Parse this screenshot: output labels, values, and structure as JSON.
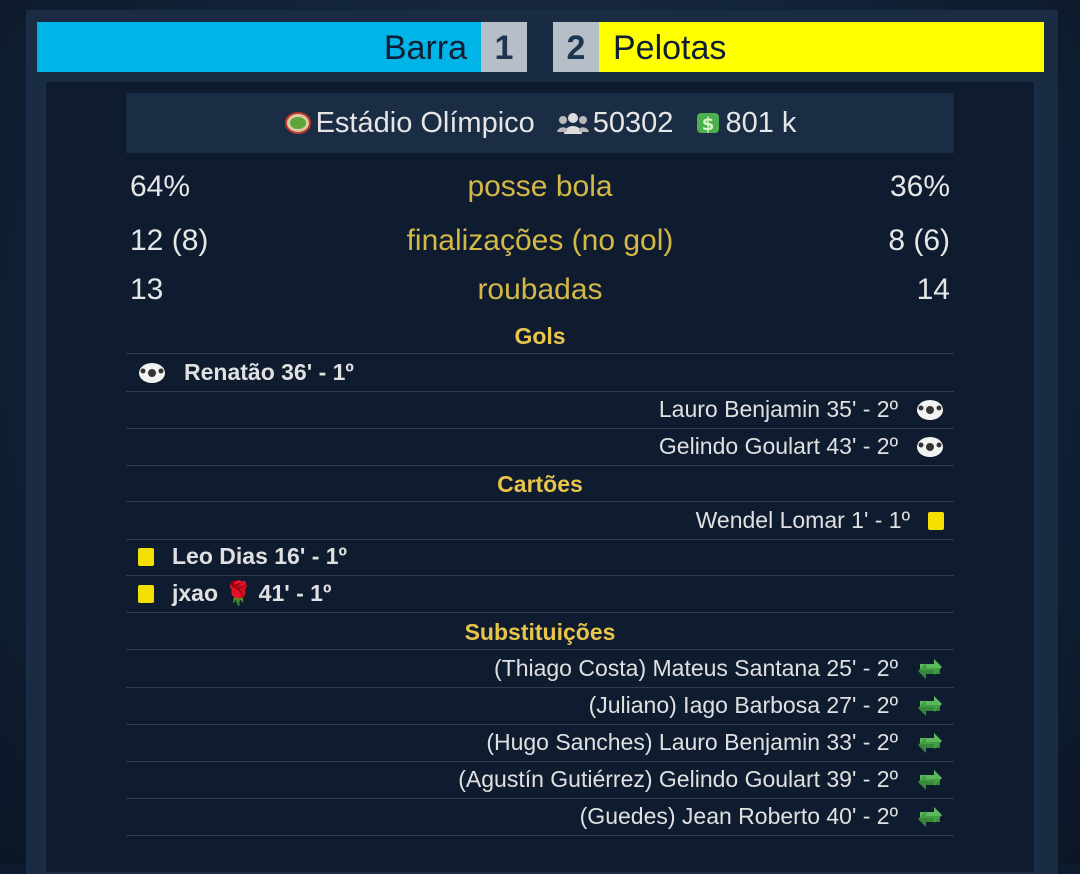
{
  "score": {
    "home_team": "Barra",
    "home_goals": "1",
    "away_goals": "2",
    "away_team": "Pelotas",
    "home_color": "#00b4e8",
    "away_color": "#ffff00"
  },
  "venue": {
    "stadium": "Estádio Olímpico",
    "attendance": "50302",
    "income": "801 k",
    "stadium_icon": "stadium-icon",
    "crowd_icon": "crowd-icon",
    "money_icon": "money-icon"
  },
  "stats": [
    {
      "home": "64%",
      "label": "posse bola",
      "away": "36%"
    },
    {
      "home": "12 (8)",
      "label": "finalizações (no gol)",
      "away": "8 (6)"
    },
    {
      "home": "13",
      "label": "roubadas",
      "away": "14"
    }
  ],
  "sections": {
    "goals": "Gols",
    "cards": "Cartões",
    "subs": "Substituições"
  },
  "goals": [
    {
      "side": "home",
      "text": "Renatão 36' - 1º"
    },
    {
      "side": "away",
      "text": "Lauro Benjamin 35' - 2º"
    },
    {
      "side": "away",
      "text": "Gelindo Goulart 43' - 2º"
    }
  ],
  "cards": [
    {
      "side": "away",
      "text": "Wendel Lomar 1' - 1º"
    },
    {
      "side": "home",
      "text": "Leo Dias 16' - 1º"
    },
    {
      "side": "home",
      "name": "jxao",
      "minute": "41' - 1º",
      "rose": "🌹"
    }
  ],
  "substitutions": [
    {
      "text": "(Thiago Costa) Mateus Santana 25' - 2º"
    },
    {
      "text": "(Juliano) Iago Barbosa 27' - 2º"
    },
    {
      "text": "(Hugo Sanches) Lauro Benjamin 33' - 2º"
    },
    {
      "text": "(Agustín Gutiérrez) Gelindo Goulart 39' - 2º"
    },
    {
      "text": "(Guedes) Jean Roberto 40' - 2º"
    }
  ]
}
